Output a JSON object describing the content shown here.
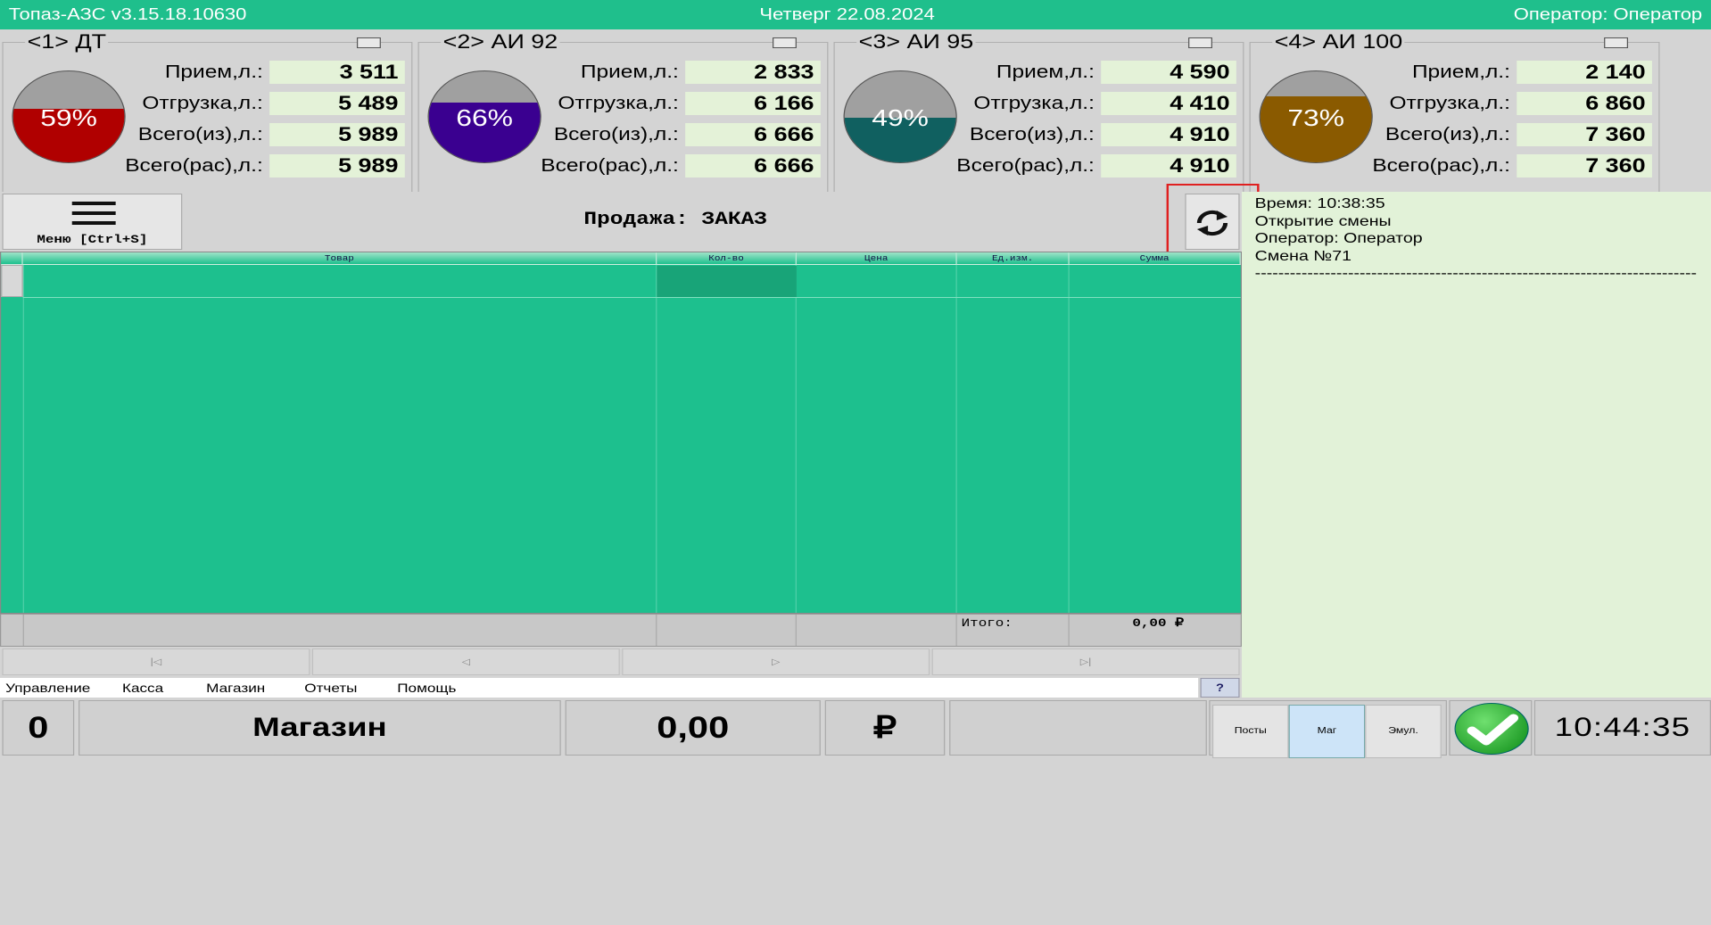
{
  "header": {
    "app_title": "Топаз-АЗС  v3.15.18.10630",
    "date": "Четверг 22.08.2024",
    "operator": "Оператор: Оператор"
  },
  "tanks": [
    {
      "title": "<1> ДТ",
      "level_pct": 59,
      "level_label": "59%",
      "fill_color": "#b00000",
      "rows": [
        {
          "label": "Прием,л.:",
          "value": "3 511"
        },
        {
          "label": "Отгрузка,л.:",
          "value": "5 489"
        },
        {
          "label": "Всего(из),л.:",
          "value": "5 989"
        },
        {
          "label": "Всего(рас),л.:",
          "value": "5 989"
        }
      ]
    },
    {
      "title": "<2> АИ 92",
      "level_pct": 66,
      "level_label": "66%",
      "fill_color": "#3a0090",
      "rows": [
        {
          "label": "Прием,л.:",
          "value": "2 833"
        },
        {
          "label": "Отгрузка,л.:",
          "value": "6 166"
        },
        {
          "label": "Всего(из),л.:",
          "value": "6 666"
        },
        {
          "label": "Всего(рас),л.:",
          "value": "6 666"
        }
      ]
    },
    {
      "title": "<3> АИ 95",
      "level_pct": 49,
      "level_label": "49%",
      "fill_color": "#106060",
      "rows": [
        {
          "label": "Прием,л.:",
          "value": "4 590"
        },
        {
          "label": "Отгрузка,л.:",
          "value": "4 410"
        },
        {
          "label": "Всего(из),л.:",
          "value": "4 910"
        },
        {
          "label": "Всего(рас),л.:",
          "value": "4 910"
        }
      ]
    },
    {
      "title": "<4> АИ 100",
      "level_pct": 73,
      "level_label": "73%",
      "fill_color": "#8a5a00",
      "rows": [
        {
          "label": "Прием,л.:",
          "value": "2 140"
        },
        {
          "label": "Отгрузка,л.:",
          "value": "6 860"
        },
        {
          "label": "Всего(из),л.:",
          "value": "7 360"
        },
        {
          "label": "Всего(рас),л.:",
          "value": "7 360"
        }
      ]
    }
  ],
  "order": {
    "menu_label": "Меню [Ctrl+S]",
    "menu_icon": "hamburger-icon",
    "title": "Продажа: ЗАКАЗ",
    "refresh_icon": "refresh-icon"
  },
  "grid": {
    "columns": [
      "Товар",
      "Кол-во",
      "Цена",
      "Ед.изм.",
      "Сумма"
    ],
    "total_label": "Итого:",
    "total_value": "0,00 ₽"
  },
  "pager": [
    "|◁",
    "◁",
    "▷",
    "▷|"
  ],
  "menubar": [
    "Управление",
    "Касса",
    "Магазин",
    "Отчеты",
    "Помощь"
  ],
  "help_label": "?",
  "journal": [
    "  Время: 10:38:35",
    "Открытие смены",
    "Оператор: Оператор",
    "Смена №71",
    "----------------------------------------------------------------------------"
  ],
  "bottom": {
    "count": "0",
    "mode": "Магазин",
    "amount": "0,00",
    "currency": "₽",
    "segments": [
      "Посты",
      "Маг",
      "Эмул."
    ],
    "active_segment": "Маг",
    "clock": "10:44:35",
    "ok_icon": "checkmark-icon"
  }
}
